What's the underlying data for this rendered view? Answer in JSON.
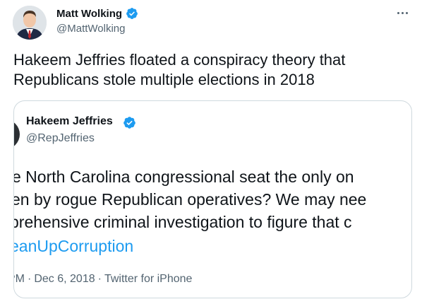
{
  "tweet": {
    "author": {
      "name": "Matt Wolking",
      "handle": "@MattWolking"
    },
    "text": "Hakeem Jeffries floated a conspiracy theory that Republicans stole multiple elections in 2018",
    "quoted": {
      "author": {
        "name": "Hakeem Jeffries",
        "handle": "@RepJeffries"
      },
      "lines": [
        "e North Carolina congressional seat the only on",
        "en by rogue Republican operatives? We may nee",
        "prehensive criminal investigation to figure that c",
        "eanUpCorruption"
      ],
      "meta": {
        "time": "PM",
        "date": "Dec 6, 2018",
        "source": "Twitter for iPhone"
      }
    }
  },
  "colors": {
    "verified": "#1d9bf0",
    "link": "#1d9bf0",
    "secondary_text": "#536471",
    "border": "#cfd9de"
  },
  "icons": {
    "more": "more-horizontal-icon",
    "verified": "verified-badge-icon"
  }
}
